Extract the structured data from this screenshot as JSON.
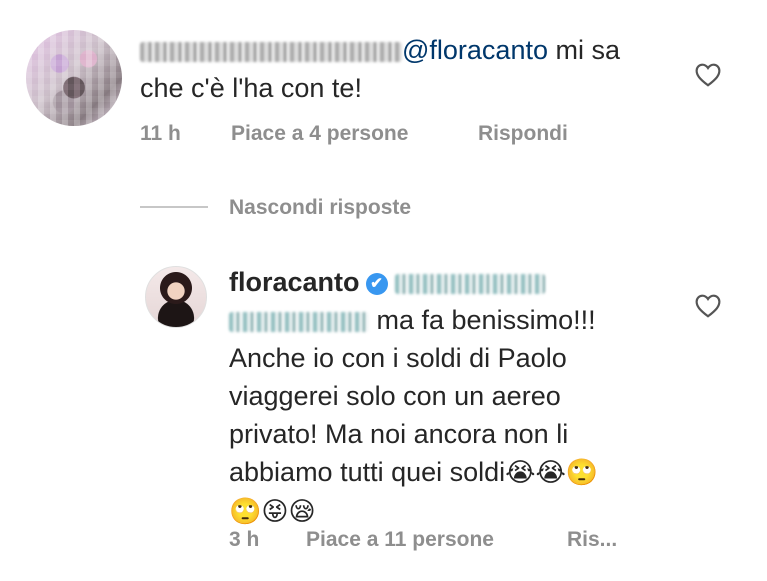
{
  "comment1": {
    "mention": "@floracanto",
    "text_line1_suffix": " mi sa",
    "text_line2": "che c'è l'ha con te!",
    "time": "11 h",
    "likes": "Piace a 4 persone",
    "reply": "Rispondi"
  },
  "replies_toggle": "Nascondi risposte",
  "comment2": {
    "username": "floracanto",
    "verified_icon": "✔",
    "line2_suffix": " ma fa benissimo!!!",
    "line3": "Anche io con i soldi di Paolo",
    "line4": "viaggerei solo con un aereo",
    "line5": "privato! Ma noi ancora non li",
    "line6_text": "abbiamo tutti quei soldi",
    "line6_emoji": "😭😭🙄",
    "line7_emoji": "🙄😝😪",
    "time": "3 h",
    "likes": "Piace a 11 persone",
    "reply": "Ris..."
  },
  "icons": {
    "heart": "heart-icon",
    "verified": "verified-badge-icon"
  }
}
